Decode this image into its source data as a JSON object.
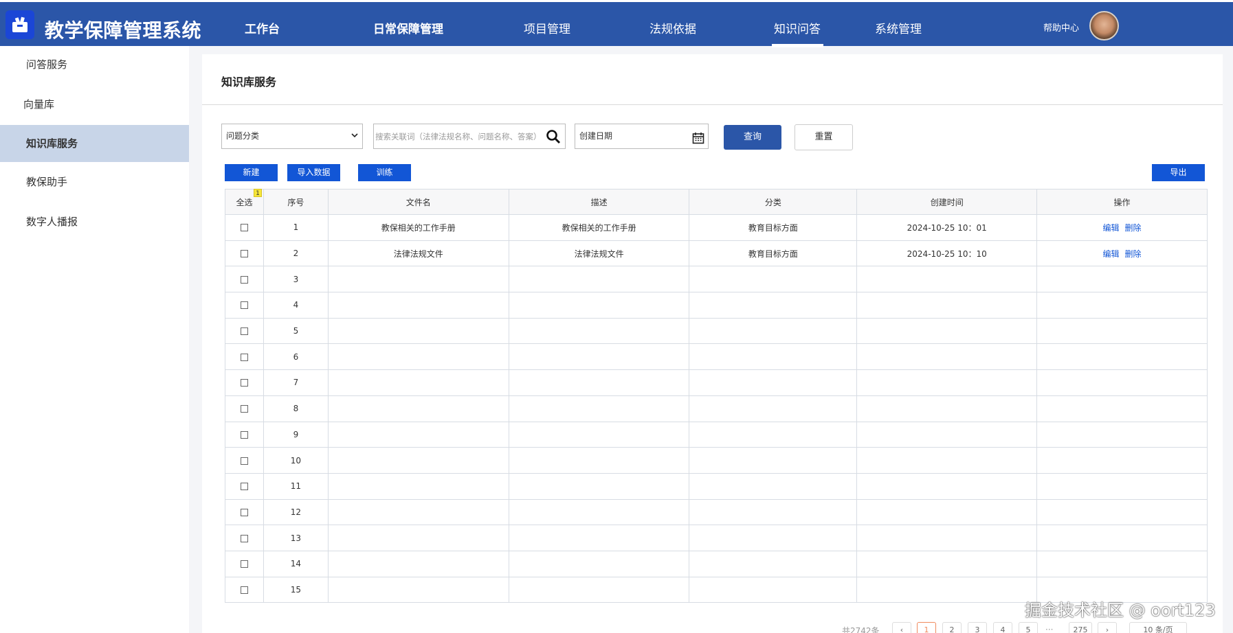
{
  "app": {
    "title": "教学保障管理系统"
  },
  "nav": [
    {
      "label": "工作台"
    },
    {
      "label": "日常保障管理"
    },
    {
      "label": "项目管理"
    },
    {
      "label": "法规依据"
    },
    {
      "label": "知识问答"
    },
    {
      "label": "系统管理"
    }
  ],
  "header": {
    "help": "帮助中心"
  },
  "sidebar": {
    "items": [
      {
        "label": "问答服务"
      },
      {
        "label": "向量库"
      },
      {
        "label": "知识库服务"
      },
      {
        "label": "教保助手"
      },
      {
        "label": "数字人播报"
      }
    ]
  },
  "page": {
    "title": "知识库服务"
  },
  "filters": {
    "category": "问题分类",
    "search_placeholder": "搜索关联词（法律法规名称、问题名称、答案）",
    "date": "创建日期",
    "query": "查询",
    "reset": "重置"
  },
  "toolbar": {
    "new": "新建",
    "import": "导入数据",
    "train": "训练",
    "export": "导出"
  },
  "table": {
    "headers": [
      "全选",
      "序号",
      "文件名",
      "描述",
      "分类",
      "创建时间",
      "操作"
    ],
    "selected_badge": "1",
    "rows": [
      {
        "no": "1",
        "filename": "教保相关的工作手册",
        "desc": "教保相关的工作手册",
        "category": "教育目标方面",
        "created": "2024-10-25 10：01",
        "edit": "编辑",
        "delete": "删除"
      },
      {
        "no": "2",
        "filename": "法律法规文件",
        "desc": "法律法规文件",
        "category": "教育目标方面",
        "created": "2024-10-25 10：10",
        "edit": "编辑",
        "delete": "删除"
      },
      {
        "no": "3"
      },
      {
        "no": "4"
      },
      {
        "no": "5"
      },
      {
        "no": "6"
      },
      {
        "no": "7"
      },
      {
        "no": "8"
      },
      {
        "no": "9"
      },
      {
        "no": "10"
      },
      {
        "no": "11"
      },
      {
        "no": "12"
      },
      {
        "no": "13"
      },
      {
        "no": "14"
      },
      {
        "no": "15"
      }
    ]
  },
  "pagination": {
    "total": "共2742条",
    "pages": [
      "1",
      "2",
      "3",
      "4",
      "5"
    ],
    "ellipsis": "···",
    "last": "275",
    "page_size": "10 条/页"
  },
  "watermark": "掘金技术社区 @ oort123"
}
